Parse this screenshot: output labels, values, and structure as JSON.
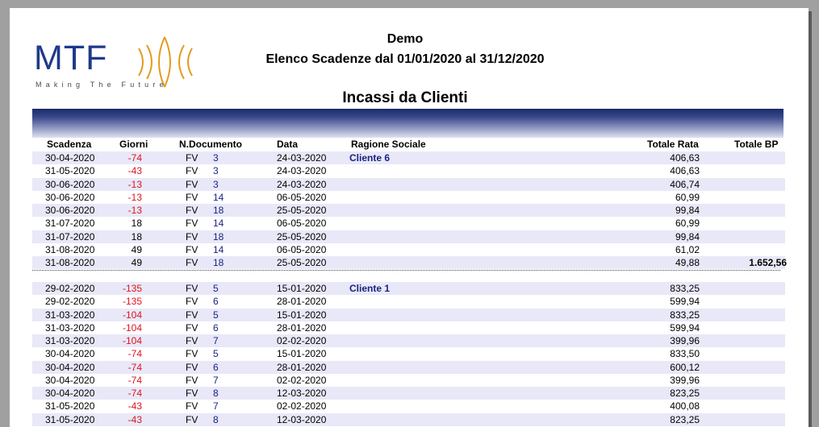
{
  "company": {
    "logo_text": "MTF",
    "logo_tagline": "Making The Future"
  },
  "header": {
    "line1": "Demo",
    "line2": "Elenco Scadenze dal 01/01/2020 al 31/12/2020"
  },
  "section_title": "Incassi da Clienti",
  "columns": {
    "scadenza": "Scadenza",
    "giorni": "Giorni",
    "documento": "N.Documento",
    "data": "Data",
    "ragione": "Ragione Sociale",
    "totale_rata": "Totale Rata",
    "totale_bp": "Totale BP"
  },
  "groups": [
    {
      "cliente": "Cliente 6",
      "totale_bp": "1.652,56",
      "rows": [
        {
          "scadenza": "30-04-2020",
          "giorni": "-74",
          "tipo": "FV",
          "numero": "3",
          "data": "24-03-2020",
          "rata": "406,63"
        },
        {
          "scadenza": "31-05-2020",
          "giorni": "-43",
          "tipo": "FV",
          "numero": "3",
          "data": "24-03-2020",
          "rata": "406,63"
        },
        {
          "scadenza": "30-06-2020",
          "giorni": "-13",
          "tipo": "FV",
          "numero": "3",
          "data": "24-03-2020",
          "rata": "406,74"
        },
        {
          "scadenza": "30-06-2020",
          "giorni": "-13",
          "tipo": "FV",
          "numero": "14",
          "data": "06-05-2020",
          "rata": "60,99"
        },
        {
          "scadenza": "30-06-2020",
          "giorni": "-13",
          "tipo": "FV",
          "numero": "18",
          "data": "25-05-2020",
          "rata": "99,84"
        },
        {
          "scadenza": "31-07-2020",
          "giorni": "18",
          "tipo": "FV",
          "numero": "14",
          "data": "06-05-2020",
          "rata": "60,99"
        },
        {
          "scadenza": "31-07-2020",
          "giorni": "18",
          "tipo": "FV",
          "numero": "18",
          "data": "25-05-2020",
          "rata": "99,84"
        },
        {
          "scadenza": "31-08-2020",
          "giorni": "49",
          "tipo": "FV",
          "numero": "14",
          "data": "06-05-2020",
          "rata": "61,02"
        },
        {
          "scadenza": "31-08-2020",
          "giorni": "49",
          "tipo": "FV",
          "numero": "18",
          "data": "25-05-2020",
          "rata": "49,88"
        }
      ]
    },
    {
      "cliente": "Cliente  1",
      "totale_bp": "",
      "rows": [
        {
          "scadenza": "29-02-2020",
          "giorni": "-135",
          "tipo": "FV",
          "numero": "5",
          "data": "15-01-2020",
          "rata": "833,25"
        },
        {
          "scadenza": "29-02-2020",
          "giorni": "-135",
          "tipo": "FV",
          "numero": "6",
          "data": "28-01-2020",
          "rata": "599,94"
        },
        {
          "scadenza": "31-03-2020",
          "giorni": "-104",
          "tipo": "FV",
          "numero": "5",
          "data": "15-01-2020",
          "rata": "833,25"
        },
        {
          "scadenza": "31-03-2020",
          "giorni": "-104",
          "tipo": "FV",
          "numero": "6",
          "data": "28-01-2020",
          "rata": "599,94"
        },
        {
          "scadenza": "31-03-2020",
          "giorni": "-104",
          "tipo": "FV",
          "numero": "7",
          "data": "02-02-2020",
          "rata": "399,96"
        },
        {
          "scadenza": "30-04-2020",
          "giorni": "-74",
          "tipo": "FV",
          "numero": "5",
          "data": "15-01-2020",
          "rata": "833,50"
        },
        {
          "scadenza": "30-04-2020",
          "giorni": "-74",
          "tipo": "FV",
          "numero": "6",
          "data": "28-01-2020",
          "rata": "600,12"
        },
        {
          "scadenza": "30-04-2020",
          "giorni": "-74",
          "tipo": "FV",
          "numero": "7",
          "data": "02-02-2020",
          "rata": "399,96"
        },
        {
          "scadenza": "30-04-2020",
          "giorni": "-74",
          "tipo": "FV",
          "numero": "8",
          "data": "12-03-2020",
          "rata": "823,25"
        },
        {
          "scadenza": "31-05-2020",
          "giorni": "-43",
          "tipo": "FV",
          "numero": "7",
          "data": "02-02-2020",
          "rata": "400,08"
        },
        {
          "scadenza": "31-05-2020",
          "giorni": "-43",
          "tipo": "FV",
          "numero": "8",
          "data": "12-03-2020",
          "rata": "823,25"
        }
      ]
    }
  ],
  "colors": {
    "negative": "#e0141e",
    "accent_blue": "#1a237e",
    "row_alt": "#e8e8f8",
    "header_band": "#1a2a6b"
  }
}
